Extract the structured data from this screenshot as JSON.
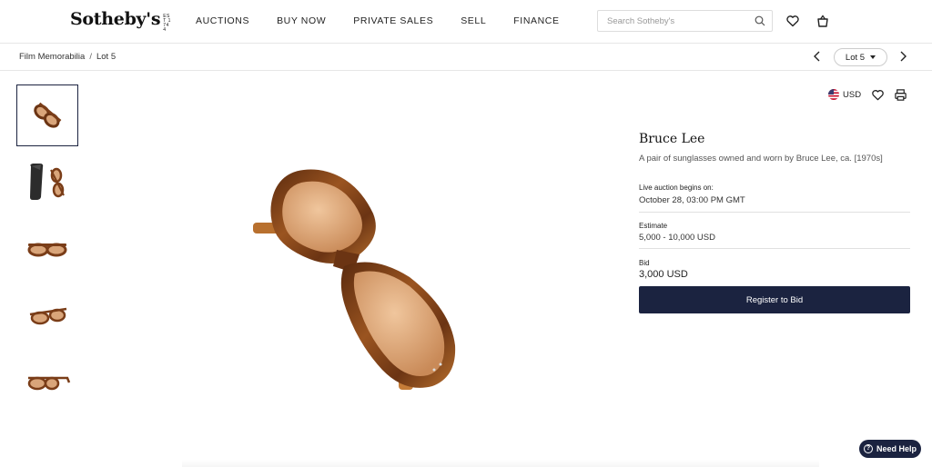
{
  "header": {
    "logo_text": "Sotheby's",
    "logo_est": "EST 1744",
    "nav": [
      "AUCTIONS",
      "BUY NOW",
      "PRIVATE SALES",
      "SELL",
      "FINANCE"
    ],
    "search_placeholder": "Search Sotheby's",
    "icons": [
      "search-icon",
      "heart-icon",
      "shopping-bag-icon"
    ]
  },
  "subheader": {
    "breadcrumb": [
      "Film Memorabilia",
      "Lot 5"
    ],
    "lot_selector": "Lot 5"
  },
  "thumbnails": [
    "sunglasses-angled",
    "case-and-sunglasses",
    "sunglasses-front",
    "sunglasses-three-quarter",
    "sunglasses-side"
  ],
  "lot": {
    "currency": "USD",
    "title": "Bruce Lee",
    "description": "A pair of sunglasses owned and worn by Bruce Lee, ca. [1970s]",
    "auction_label": "Live auction begins on:",
    "auction_date": "October 28, 03:00 PM GMT",
    "estimate_label": "Estimate",
    "estimate_value": "5,000 - 10,000 USD",
    "bid_label": "Bid",
    "bid_value": "3,000 USD",
    "register_label": "Register to Bid"
  },
  "help": {
    "label": "Need Help"
  },
  "colors": {
    "navy": "#1b2340",
    "tortoise": "#7a3d18",
    "lens": "#d9a57a"
  }
}
